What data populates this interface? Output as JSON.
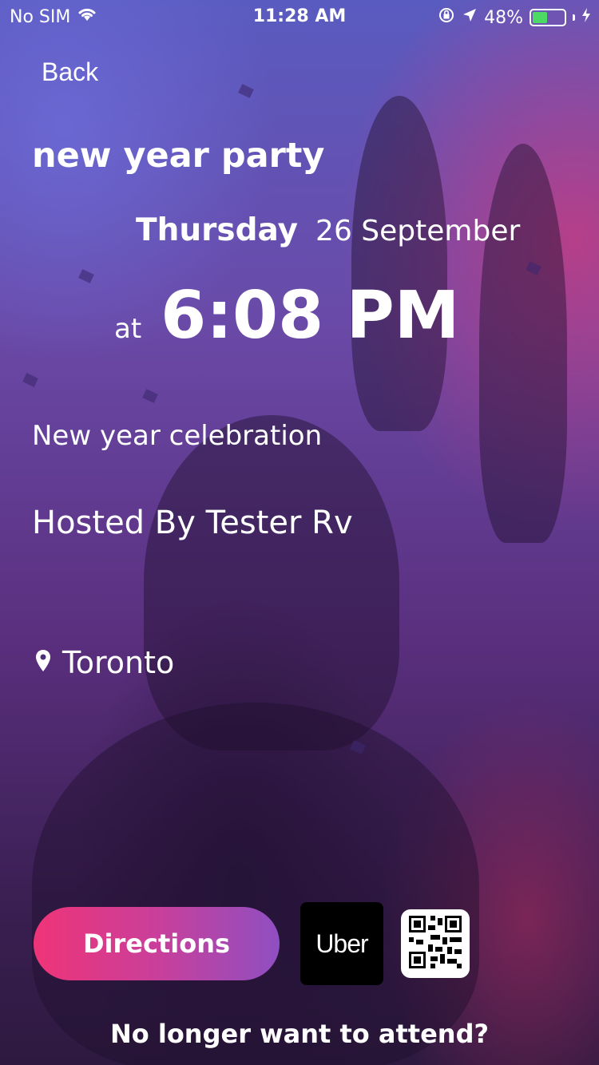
{
  "status_bar": {
    "carrier": "No SIM",
    "time": "11:28 AM",
    "battery_percent": "48%",
    "battery_level": 0.48,
    "icons": [
      "wifi-icon",
      "orientation-lock-icon",
      "location-arrow-icon",
      "battery-icon",
      "charging-bolt-icon"
    ]
  },
  "nav": {
    "back_label": "Back"
  },
  "event": {
    "title": "new year party",
    "day_of_week": "Thursday",
    "date": "26 September",
    "at_label": "at",
    "time": "6:08 PM",
    "description": "New year celebration",
    "host": "Hosted By Tester Rv",
    "location": "Toronto",
    "location_icon": "map-pin-icon"
  },
  "actions": {
    "directions_label": "Directions",
    "uber_label": "Uber",
    "qr_icon": "qr-code-icon",
    "leave_label": "No longer want to attend?"
  },
  "colors": {
    "directions_gradient_start": "#ef3478",
    "directions_gradient_end": "#8f4fc2",
    "battery_fill": "#4cd964",
    "uber_bg": "#000000"
  }
}
